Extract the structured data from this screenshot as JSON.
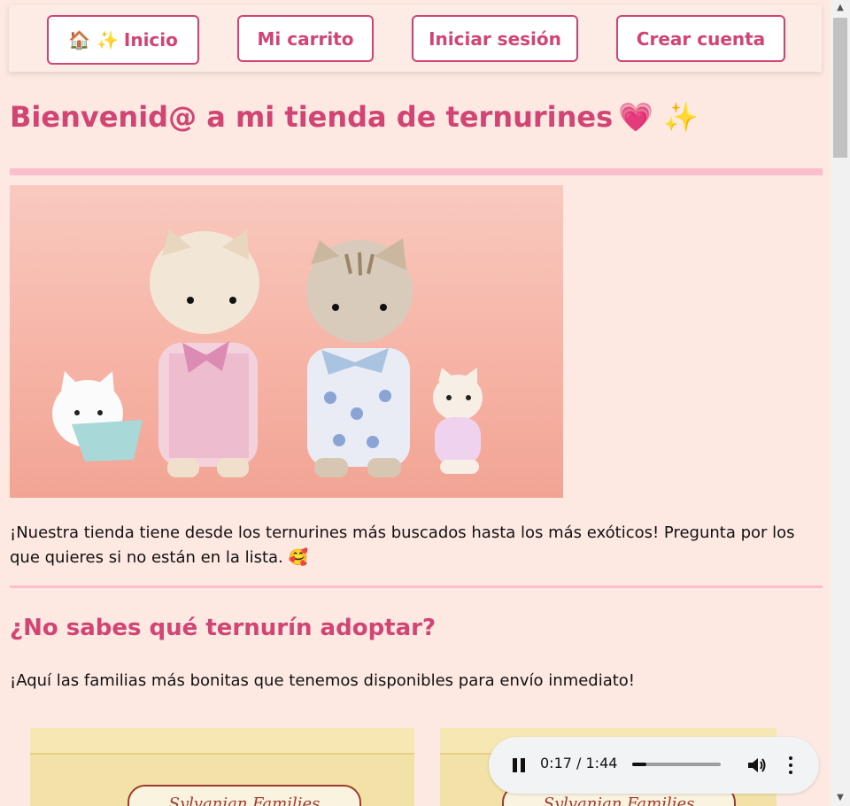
{
  "nav": {
    "home": {
      "icon": "🏠 ✨",
      "label": "Inicio"
    },
    "cart": "Mi carrito",
    "login": "Iniciar sesión",
    "signup": "Crear cuenta"
  },
  "header": {
    "title": "Bienvenid@ a mi tienda de ternurines",
    "emoji": "💗 ✨"
  },
  "intro": "¡Nuestra tienda tiene desde los ternurines más buscados hasta los más exóticos! Pregunta por los que quieres si no están en la lista. 🥰",
  "section": {
    "title": "¿No sabes qué ternurín adoptar?",
    "text": "¡Aquí las familias más bonitas que tenemos disponibles para envío inmediato!"
  },
  "products": [
    {
      "label": "Sylvanian Families"
    },
    {
      "label": "Sylvanian Families"
    }
  ],
  "audio": {
    "time": "0:17 / 1:44",
    "progress": 0.163
  },
  "colors": {
    "accent": "#d24474",
    "background": "#fde9e2",
    "rule": "#fbbfcb"
  }
}
